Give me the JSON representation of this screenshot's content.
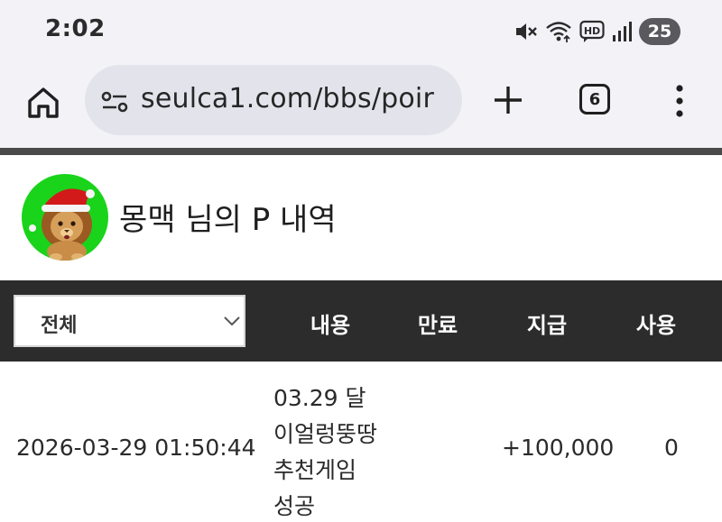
{
  "status_bar": {
    "time": "2:02",
    "battery_level": "25",
    "icons": [
      "mute-vibrate-icon",
      "wifi-icon",
      "hd-voice-icon",
      "signal-icon",
      "battery-icon"
    ]
  },
  "browser": {
    "url": "seulca1.com/bbs/poir",
    "tab_count": "6",
    "icons": [
      "home-icon",
      "site-info-icon",
      "plus-icon",
      "tab-switcher-icon",
      "more-vert-icon"
    ]
  },
  "profile": {
    "title": "몽맥 님의 P 내역",
    "avatar_bg": "#19d41a"
  },
  "filter": {
    "selected": "전체"
  },
  "table": {
    "headers": [
      "내용",
      "만료",
      "지급",
      "사용"
    ],
    "rows": [
      {
        "date": "2026-03-29 01:50:44",
        "content_lines": [
          "03.29 달",
          "이얼렁뚱땅",
          "추천게임",
          "성공"
        ],
        "expire": "",
        "grant": "+100,000",
        "use": "0"
      }
    ]
  },
  "colors": {
    "chrome_bg": "#f2f2f7",
    "omnibox_bg": "#e3e3eb",
    "header_bar": "#2c2c2c",
    "accent_green": "#19d41a"
  }
}
